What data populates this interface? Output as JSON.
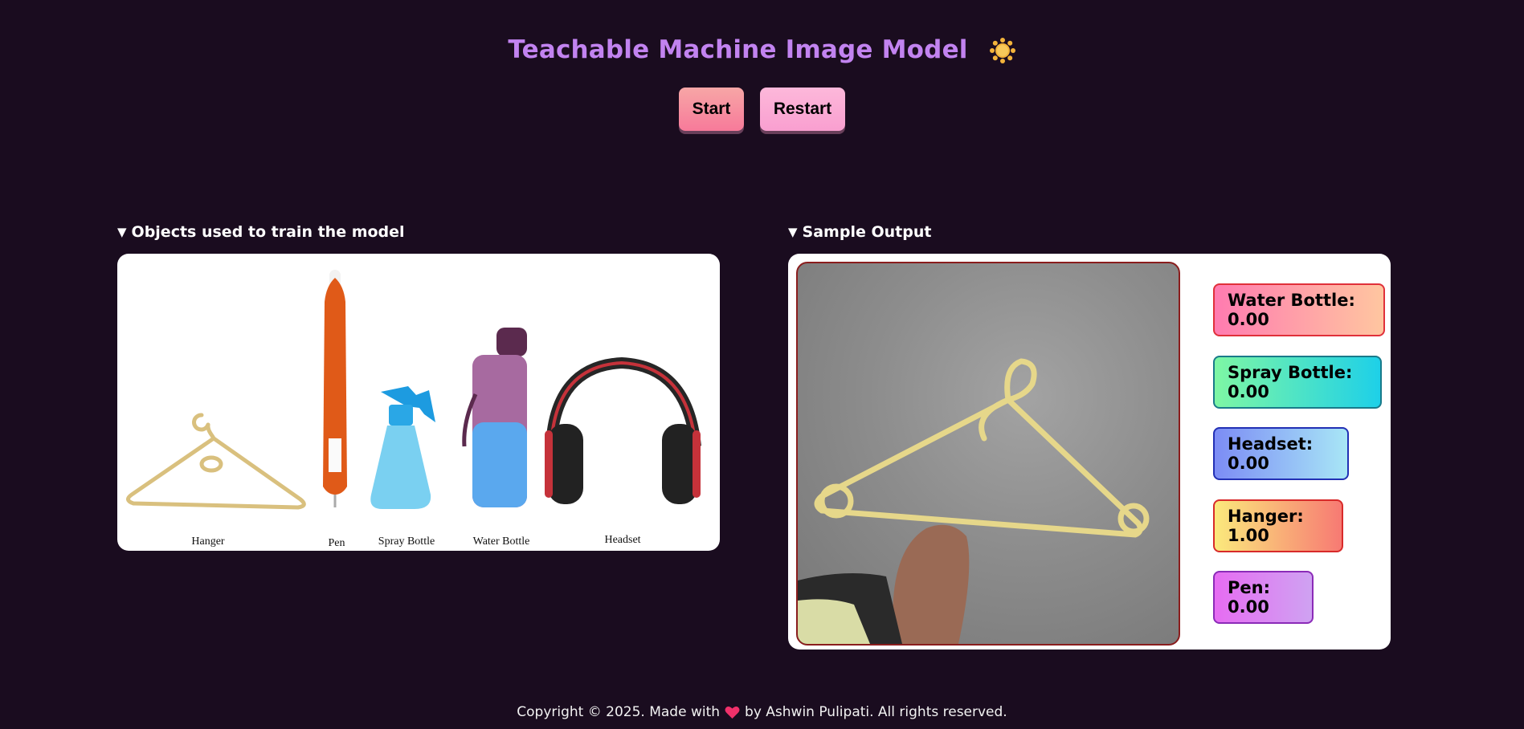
{
  "header": {
    "title": "Teachable Machine Image Model",
    "theme_icon": "sun-icon",
    "start_label": "Start",
    "restart_label": "Restart"
  },
  "training": {
    "heading": "Objects used to train the model",
    "objects": [
      "Hanger",
      "Pen",
      "Spray Bottle",
      "Water Bottle",
      "Headset"
    ]
  },
  "output": {
    "heading": "Sample Output",
    "predictions": [
      {
        "label": "Water Bottle: 0.00"
      },
      {
        "label": "Spray Bottle: 0.00"
      },
      {
        "label": "Headset: 0.00"
      },
      {
        "label": "Hanger: 1.00"
      },
      {
        "label": "Pen: 0.00"
      }
    ]
  },
  "footer": {
    "before": "Copyright © 2025. Made with",
    "icon": "heart-icon",
    "after": "by Ashwin Pulipati. All rights reserved."
  },
  "colors": {
    "background": "#1a0c1f",
    "title": "#c283f0"
  }
}
